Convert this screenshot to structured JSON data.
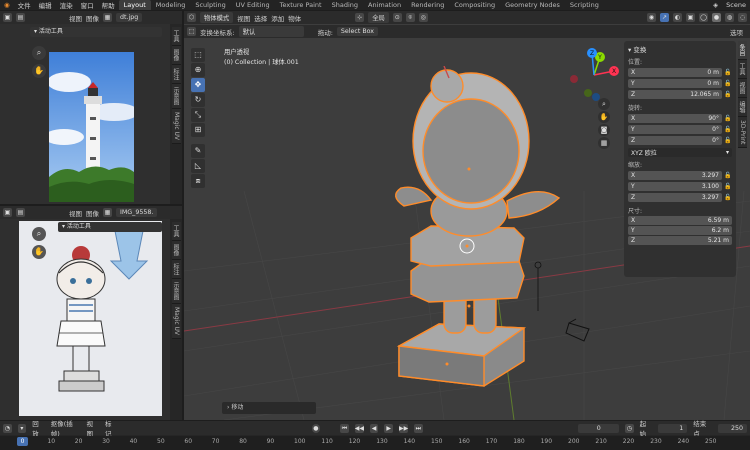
{
  "topbar": {
    "menus": [
      "文件",
      "编辑",
      "渲染",
      "窗口",
      "帮助"
    ],
    "workspaces": [
      "Layout",
      "Modeling",
      "Sculpting",
      "UV Editing",
      "Texture Paint",
      "Shading",
      "Animation",
      "Rendering",
      "Compositing",
      "Geometry Nodes",
      "Scripting"
    ],
    "scene_label": "Scene"
  },
  "image_editor_top": {
    "menus": [
      "视图",
      "图像"
    ],
    "filename": "dt.jpg",
    "tool_panel_title": "活动工具",
    "side_tabs": [
      "工具",
      "图像",
      "标注",
      "示意图",
      "Magic UV"
    ]
  },
  "image_editor_bottom": {
    "menus": [
      "视图",
      "图像"
    ],
    "filename": "IMG_9558.",
    "tool_panel_title": "活动工具",
    "side_tabs": [
      "工具",
      "图像",
      "标注",
      "示意图",
      "Magic UV"
    ]
  },
  "viewport": {
    "mode_label": "物体模式",
    "menus": [
      "视图",
      "选择",
      "添加",
      "物体"
    ],
    "orientation_label": "全局",
    "transform_label": "变换坐标系:",
    "transform_value": "默认",
    "drag_label": "拖动:",
    "drag_value": "Select Box",
    "options_label": "选项",
    "info_line1": "用户透视",
    "info_line2": "(0) Collection | 球体.001",
    "last_op_label": "移动",
    "gizmo": {
      "x": "X",
      "y": "Y",
      "z": "Z"
    },
    "right_tabs": [
      "条目",
      "工具",
      "视图",
      "编辑",
      "3D-Print"
    ]
  },
  "npanel": {
    "header": "变换",
    "location_label": "位置:",
    "location": [
      {
        "axis": "X",
        "value": "0 m"
      },
      {
        "axis": "Y",
        "value": "0 m"
      },
      {
        "axis": "Z",
        "value": "12.065 m"
      }
    ],
    "rotation_label": "旋转:",
    "rotation": [
      {
        "axis": "X",
        "value": "90°"
      },
      {
        "axis": "Y",
        "value": "0°"
      },
      {
        "axis": "Z",
        "value": "0°"
      }
    ],
    "rotation_mode": "XYZ 欧拉",
    "scale_label": "缩放:",
    "scale": [
      {
        "axis": "X",
        "value": "3.297"
      },
      {
        "axis": "Y",
        "value": "3.100"
      },
      {
        "axis": "Z",
        "value": "3.297"
      }
    ],
    "dimensions_label": "尺寸:",
    "dimensions": [
      {
        "axis": "X",
        "value": "6.59 m"
      },
      {
        "axis": "Y",
        "value": "6.2 m"
      },
      {
        "axis": "Z",
        "value": "5.21 m"
      }
    ]
  },
  "timeline": {
    "menus": [
      "回放",
      "抠像(插帧)",
      "视图",
      "标记"
    ],
    "current_frame": "0",
    "start_label": "起始",
    "start_value": "1",
    "end_label": "结束点",
    "end_value": "250",
    "ruler": [
      "0",
      "10",
      "20",
      "30",
      "40",
      "50",
      "60",
      "70",
      "80",
      "90",
      "100",
      "110",
      "120",
      "130",
      "140",
      "150",
      "160",
      "170",
      "180",
      "190",
      "200",
      "210",
      "220",
      "230",
      "240",
      "250"
    ]
  },
  "colors": {
    "accent": "#4772b3",
    "selection": "#ff8c2a",
    "viewport_bg": "#3d3d3d",
    "x_axis": "#ff3352",
    "y_axis": "#8bdc00",
    "z_axis": "#2890ff"
  }
}
